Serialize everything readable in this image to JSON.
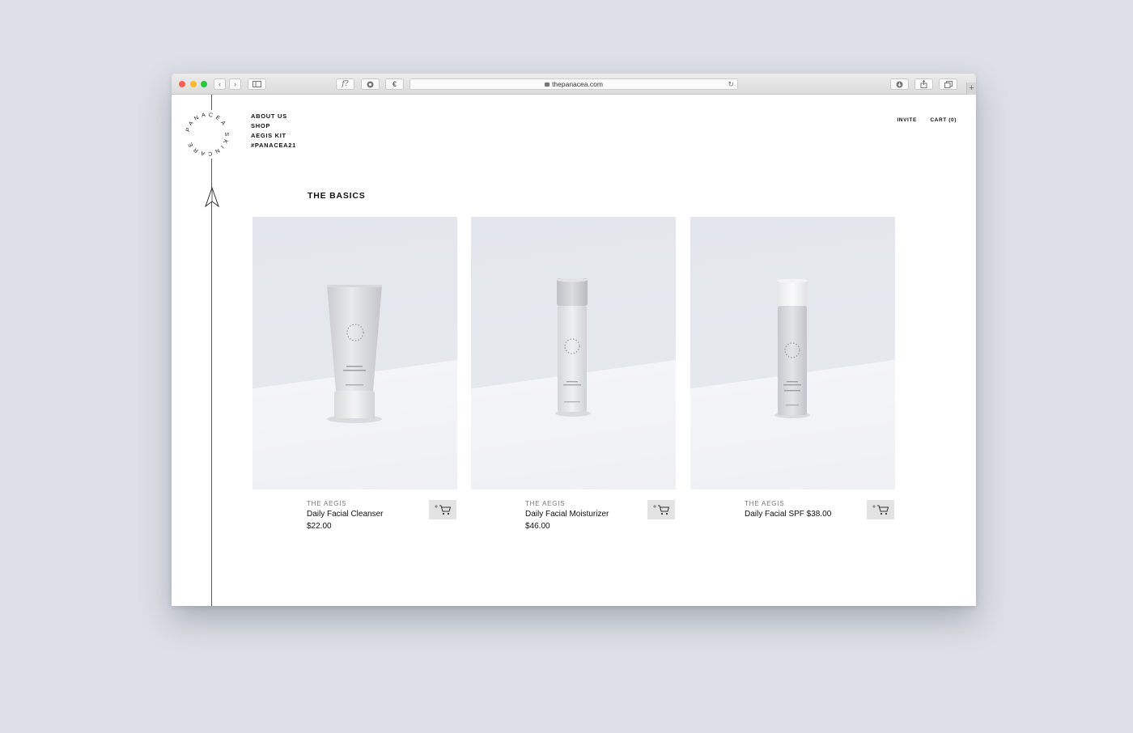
{
  "browser": {
    "url": "thepanacea.com",
    "new_tab_label": "+"
  },
  "site": {
    "logo_text": "PANACEA SKINCARE",
    "nav": [
      "ABOUT US",
      "SHOP",
      "AEGIS KIT",
      "#PANACEA21"
    ],
    "invite_label": "INVITE",
    "cart_label": "CART (0)"
  },
  "section": {
    "title": "THE BASICS"
  },
  "products": [
    {
      "brand": "THE AEGIS",
      "name": "Daily Facial Cleanser",
      "price": "$22.00",
      "type": "tube"
    },
    {
      "brand": "THE AEGIS",
      "name": "Daily Facial Moisturizer",
      "price": "$46.00",
      "type": "bottle"
    },
    {
      "brand": "THE AEGIS",
      "name": "Daily Facial SPF $38.00",
      "price": "",
      "type": "bottle"
    }
  ],
  "icons": {
    "cart": "add-to-cart-icon",
    "logo": "panacea-ring-logo",
    "arrow": "paper-plane-arrow-icon"
  },
  "colors": {
    "background": "#dde0e6",
    "rule_line": "#5a5a5a",
    "cart_button": "#e3e3e3"
  }
}
